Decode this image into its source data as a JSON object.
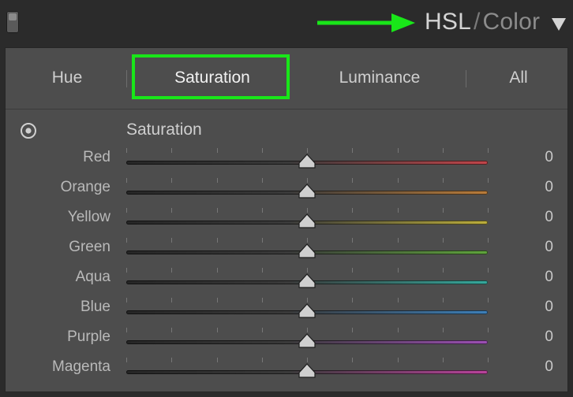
{
  "header": {
    "title_primary": "HSL",
    "title_separator": "/",
    "title_secondary": "Color",
    "arrow_color": "#19e619",
    "collapse_icon": "triangle-down-icon",
    "switch_icon": "panel-toggle-icon"
  },
  "tabs": [
    {
      "label": "Hue",
      "active": false
    },
    {
      "label": "Saturation",
      "active": true
    },
    {
      "label": "Luminance",
      "active": false
    },
    {
      "label": "All",
      "active": false
    }
  ],
  "highlight_color": "#19e619",
  "section": {
    "label": "Saturation",
    "target_icon": "target-adjustment-icon"
  },
  "sliders": [
    {
      "label": "Red",
      "value": "0",
      "min": -100,
      "max": 100,
      "color": "#c0454a"
    },
    {
      "label": "Orange",
      "value": "0",
      "min": -100,
      "max": 100,
      "color": "#b97c3a"
    },
    {
      "label": "Yellow",
      "value": "0",
      "min": -100,
      "max": 100,
      "color": "#bcae3c"
    },
    {
      "label": "Green",
      "value": "0",
      "min": -100,
      "max": 100,
      "color": "#5fa43c"
    },
    {
      "label": "Aqua",
      "value": "0",
      "min": -100,
      "max": 100,
      "color": "#36a89c"
    },
    {
      "label": "Blue",
      "value": "0",
      "min": -100,
      "max": 100,
      "color": "#3d7fb8"
    },
    {
      "label": "Purple",
      "value": "0",
      "min": -100,
      "max": 100,
      "color": "#9c4fb4"
    },
    {
      "label": "Magenta",
      "value": "0",
      "min": -100,
      "max": 100,
      "color": "#b9439c"
    }
  ]
}
